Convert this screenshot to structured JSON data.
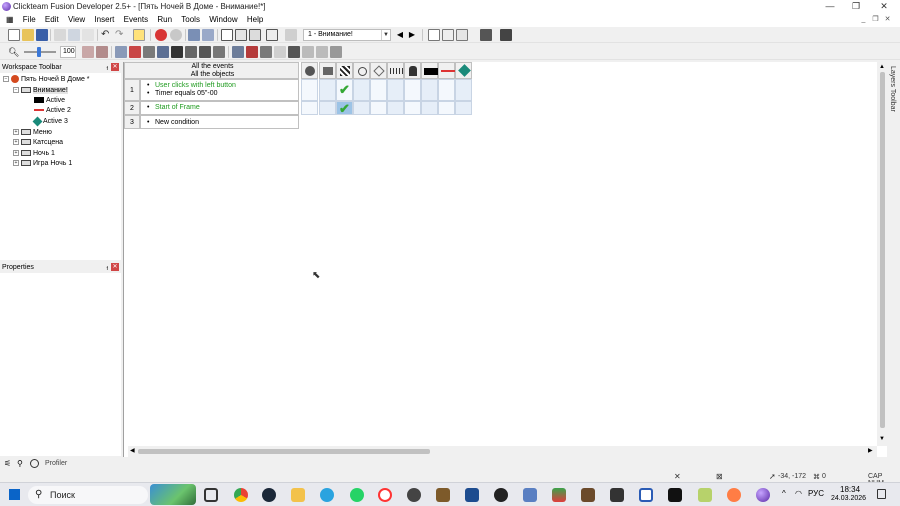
{
  "window": {
    "title": "Clickteam Fusion Developer 2.5+ - [Пять Ночей В Доме - Внимание!*]",
    "controls": [
      "—",
      "❐",
      "✕"
    ]
  },
  "menu": [
    "File",
    "Edit",
    "View",
    "Insert",
    "Events",
    "Run",
    "Tools",
    "Window",
    "Help"
  ],
  "toolbar": {
    "frame_combo": "1 - Внимание!",
    "zoom_value": "100"
  },
  "workspace": {
    "title": "Workspace Toolbar",
    "pin": "ᵻ",
    "close": "✕",
    "tree": [
      {
        "label": "Пять Ночей В Доме *",
        "level": 0,
        "exp": "−"
      },
      {
        "label": "Внимание!",
        "level": 1,
        "exp": "−",
        "selected": true
      },
      {
        "label": "Active",
        "level": 2,
        "icon": "black"
      },
      {
        "label": "Active 2",
        "level": 2,
        "icon": "red"
      },
      {
        "label": "Active 3",
        "level": 2,
        "icon": "diamond"
      },
      {
        "label": "Меню",
        "level": 1,
        "exp": "+"
      },
      {
        "label": "Катсцена",
        "level": 1,
        "exp": "+"
      },
      {
        "label": "Ночь 1",
        "level": 1,
        "exp": "+"
      },
      {
        "label": "Игра Ночь 1",
        "level": 1,
        "exp": "+"
      }
    ]
  },
  "properties": {
    "title": "Properties"
  },
  "bottom_tabs": {
    "profiler": "Profiler"
  },
  "events": {
    "header": [
      "All the events",
      "All the objects"
    ],
    "rows": [
      {
        "num": "1",
        "lines": [
          "User clicks with left button",
          "Timer equals 05\"-00"
        ]
      },
      {
        "num": "2",
        "lines": [
          "Start of Frame"
        ]
      },
      {
        "num": "3",
        "lines": [
          "New condition"
        ]
      }
    ]
  },
  "layers_toolbar": "Layers Toolbar",
  "status": {
    "coords": "-34, -172",
    "zero": "0",
    "caps": "CAP NUM"
  },
  "taskbar": {
    "search": "Поиск",
    "lang": "РУС",
    "time": "18:34",
    "date": "24.03.2026"
  }
}
